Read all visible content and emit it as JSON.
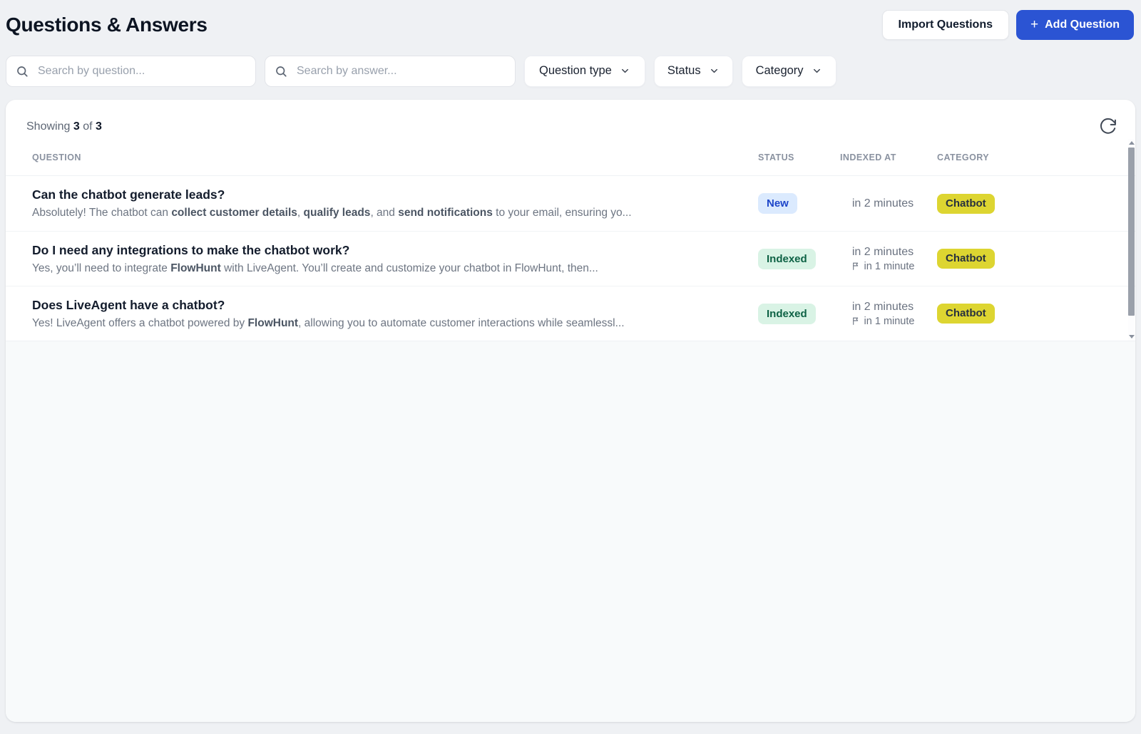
{
  "header": {
    "title": "Questions & Answers",
    "import_button": "Import Questions",
    "plus_icon": "+",
    "add_button": "Add Question"
  },
  "filters": {
    "search_question": {
      "placeholder": "Search by question...",
      "value": ""
    },
    "search_answer": {
      "placeholder": "Search by answer...",
      "value": ""
    },
    "question_type_dropdown": "Question type",
    "status_dropdown": "Status",
    "category_dropdown": "Category"
  },
  "table": {
    "showing_prefix": "Showing",
    "showing_count": "3",
    "showing_of": "of",
    "showing_total": "3",
    "columns": {
      "question": "QUESTION",
      "status": "STATUS",
      "indexed_at": "INDEXED AT",
      "category": "CATEGORY"
    },
    "rows": [
      {
        "question": "Can the chatbot generate leads?",
        "answer": [
          {
            "text": "Absolutely! The chatbot can ",
            "bold": false
          },
          {
            "text": "collect customer details",
            "bold": true
          },
          {
            "text": ", ",
            "bold": false
          },
          {
            "text": "qualify leads",
            "bold": true
          },
          {
            "text": ", and ",
            "bold": false
          },
          {
            "text": "send notifications",
            "bold": true
          },
          {
            "text": " to your email, ensuring yo...",
            "bold": false
          }
        ],
        "status": "New",
        "status_type": "new",
        "indexed_at": "in 2 minutes",
        "reindex_in": null,
        "category": "Chatbot"
      },
      {
        "question": "Do I need any integrations to make the chatbot work?",
        "answer": [
          {
            "text": "Yes, you’ll need to integrate ",
            "bold": false
          },
          {
            "text": "FlowHunt",
            "bold": true
          },
          {
            "text": " with LiveAgent. You’ll create and customize your chatbot in FlowHunt, then...",
            "bold": false
          }
        ],
        "status": "Indexed",
        "status_type": "indexed",
        "indexed_at": "in 2 minutes",
        "reindex_in": "in 1 minute",
        "category": "Chatbot"
      },
      {
        "question": "Does LiveAgent have a chatbot?",
        "answer": [
          {
            "text": "Yes! LiveAgent offers a chatbot powered by ",
            "bold": false
          },
          {
            "text": "FlowHunt",
            "bold": true
          },
          {
            "text": ", allowing you to automate customer interactions while seamlessl...",
            "bold": false
          }
        ],
        "status": "Indexed",
        "status_type": "indexed",
        "indexed_at": "in 2 minutes",
        "reindex_in": "in 1 minute",
        "category": "Chatbot"
      }
    ]
  },
  "icons": {
    "search": "search-icon",
    "chevron": "chevron-down-icon",
    "refresh": "refresh-icon",
    "plus": "plus-icon",
    "flag": "flag-icon"
  },
  "colors": {
    "page_bg": "#eff1f4",
    "card_bg": "#ffffff",
    "card_footer_bg": "#f8fafb",
    "accent_blue": "#2b54d3",
    "badge_new_bg": "#dbeafe",
    "badge_new_text": "#1d45c9",
    "badge_indexed_bg": "#d9f3e5",
    "badge_indexed_text": "#0e6245",
    "badge_category_bg": "#ddd531",
    "badge_category_text": "#27303f"
  }
}
